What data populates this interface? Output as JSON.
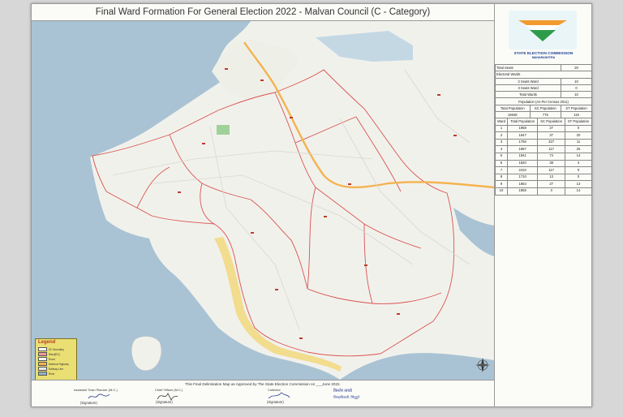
{
  "map": {
    "title": "Final Ward Formation For General Election 2022 -  Malvan Council (C - Category)",
    "legend": {
      "title": "Legend",
      "items": [
        {
          "label": "SC Boundary",
          "color": "#ffffff"
        },
        {
          "label": "Ward(EC)",
          "color": "#ef9a9a"
        },
        {
          "label": "Road",
          "color": "#f5f5f5"
        },
        {
          "label": "National Highway",
          "color": "#f4b350"
        },
        {
          "label": "Railway Line",
          "color": "#e6e6e6"
        },
        {
          "label": "River",
          "color": "#8fb5c7"
        }
      ]
    },
    "colors": {
      "sea": "#a9c3d4",
      "land": "#f1f1ec",
      "beach": "#f2dc8e",
      "highway": "#f4b350",
      "ward_line": "#d9534f"
    }
  },
  "panel": {
    "org_name": "STATE ELECTION COMMISSION",
    "org_sub": "MAHARASHTRA",
    "total_seats_label": "Total Seats",
    "total_seats_value": "20",
    "electoral_wards_label": "Electoral Wards",
    "two_seat_label": "2 Seats Ward",
    "two_seat_value": "10",
    "three_seat_label": "3 Seats Ward",
    "three_seat_value": "0",
    "total_wards_label": "Total Wards",
    "total_wards_value": "10",
    "population_heading": "Population (As Per Census 2011)",
    "total_pop_label": "Total Population",
    "total_pop_value": "18648",
    "sc_pop_label": "SC Population",
    "sc_pop_value": "775",
    "st_pop_label": "ST Population",
    "st_pop_value": "119",
    "ward_table": {
      "headers": [
        "Ward",
        "Total Population",
        "SC Population",
        "ST Population"
      ],
      "rows": [
        [
          "1",
          "1958",
          "27",
          "0"
        ],
        [
          "2",
          "1647",
          "37",
          "20"
        ],
        [
          "3",
          "1756",
          "327",
          "11"
        ],
        [
          "4",
          "1867",
          "117",
          "25"
        ],
        [
          "5",
          "1941",
          "74",
          "14"
        ],
        [
          "6",
          "1820",
          "38",
          "4"
        ],
        [
          "7",
          "2410",
          "117",
          "0"
        ],
        [
          "8",
          "1710",
          "13",
          "0"
        ],
        [
          "9",
          "1664",
          "27",
          "13"
        ],
        [
          "10",
          "1855",
          "3",
          "14"
        ]
      ]
    }
  },
  "footer": {
    "note": "This Final Delimitation Map as Approved by The State Election Commission on ___June 2022.",
    "atp_label": "Assistant Town Planner (M.C.)",
    "co_label": "Chief Officer (M.C.)",
    "collector_label": "Collector",
    "sig1": "(Signature)",
    "sig2": "(Signature)",
    "sig3": "(Signature)",
    "marathi_name": "किशोर तावडे",
    "marathi_title": "जिल्हाधिकारी, सिंधुदुर्ग"
  }
}
